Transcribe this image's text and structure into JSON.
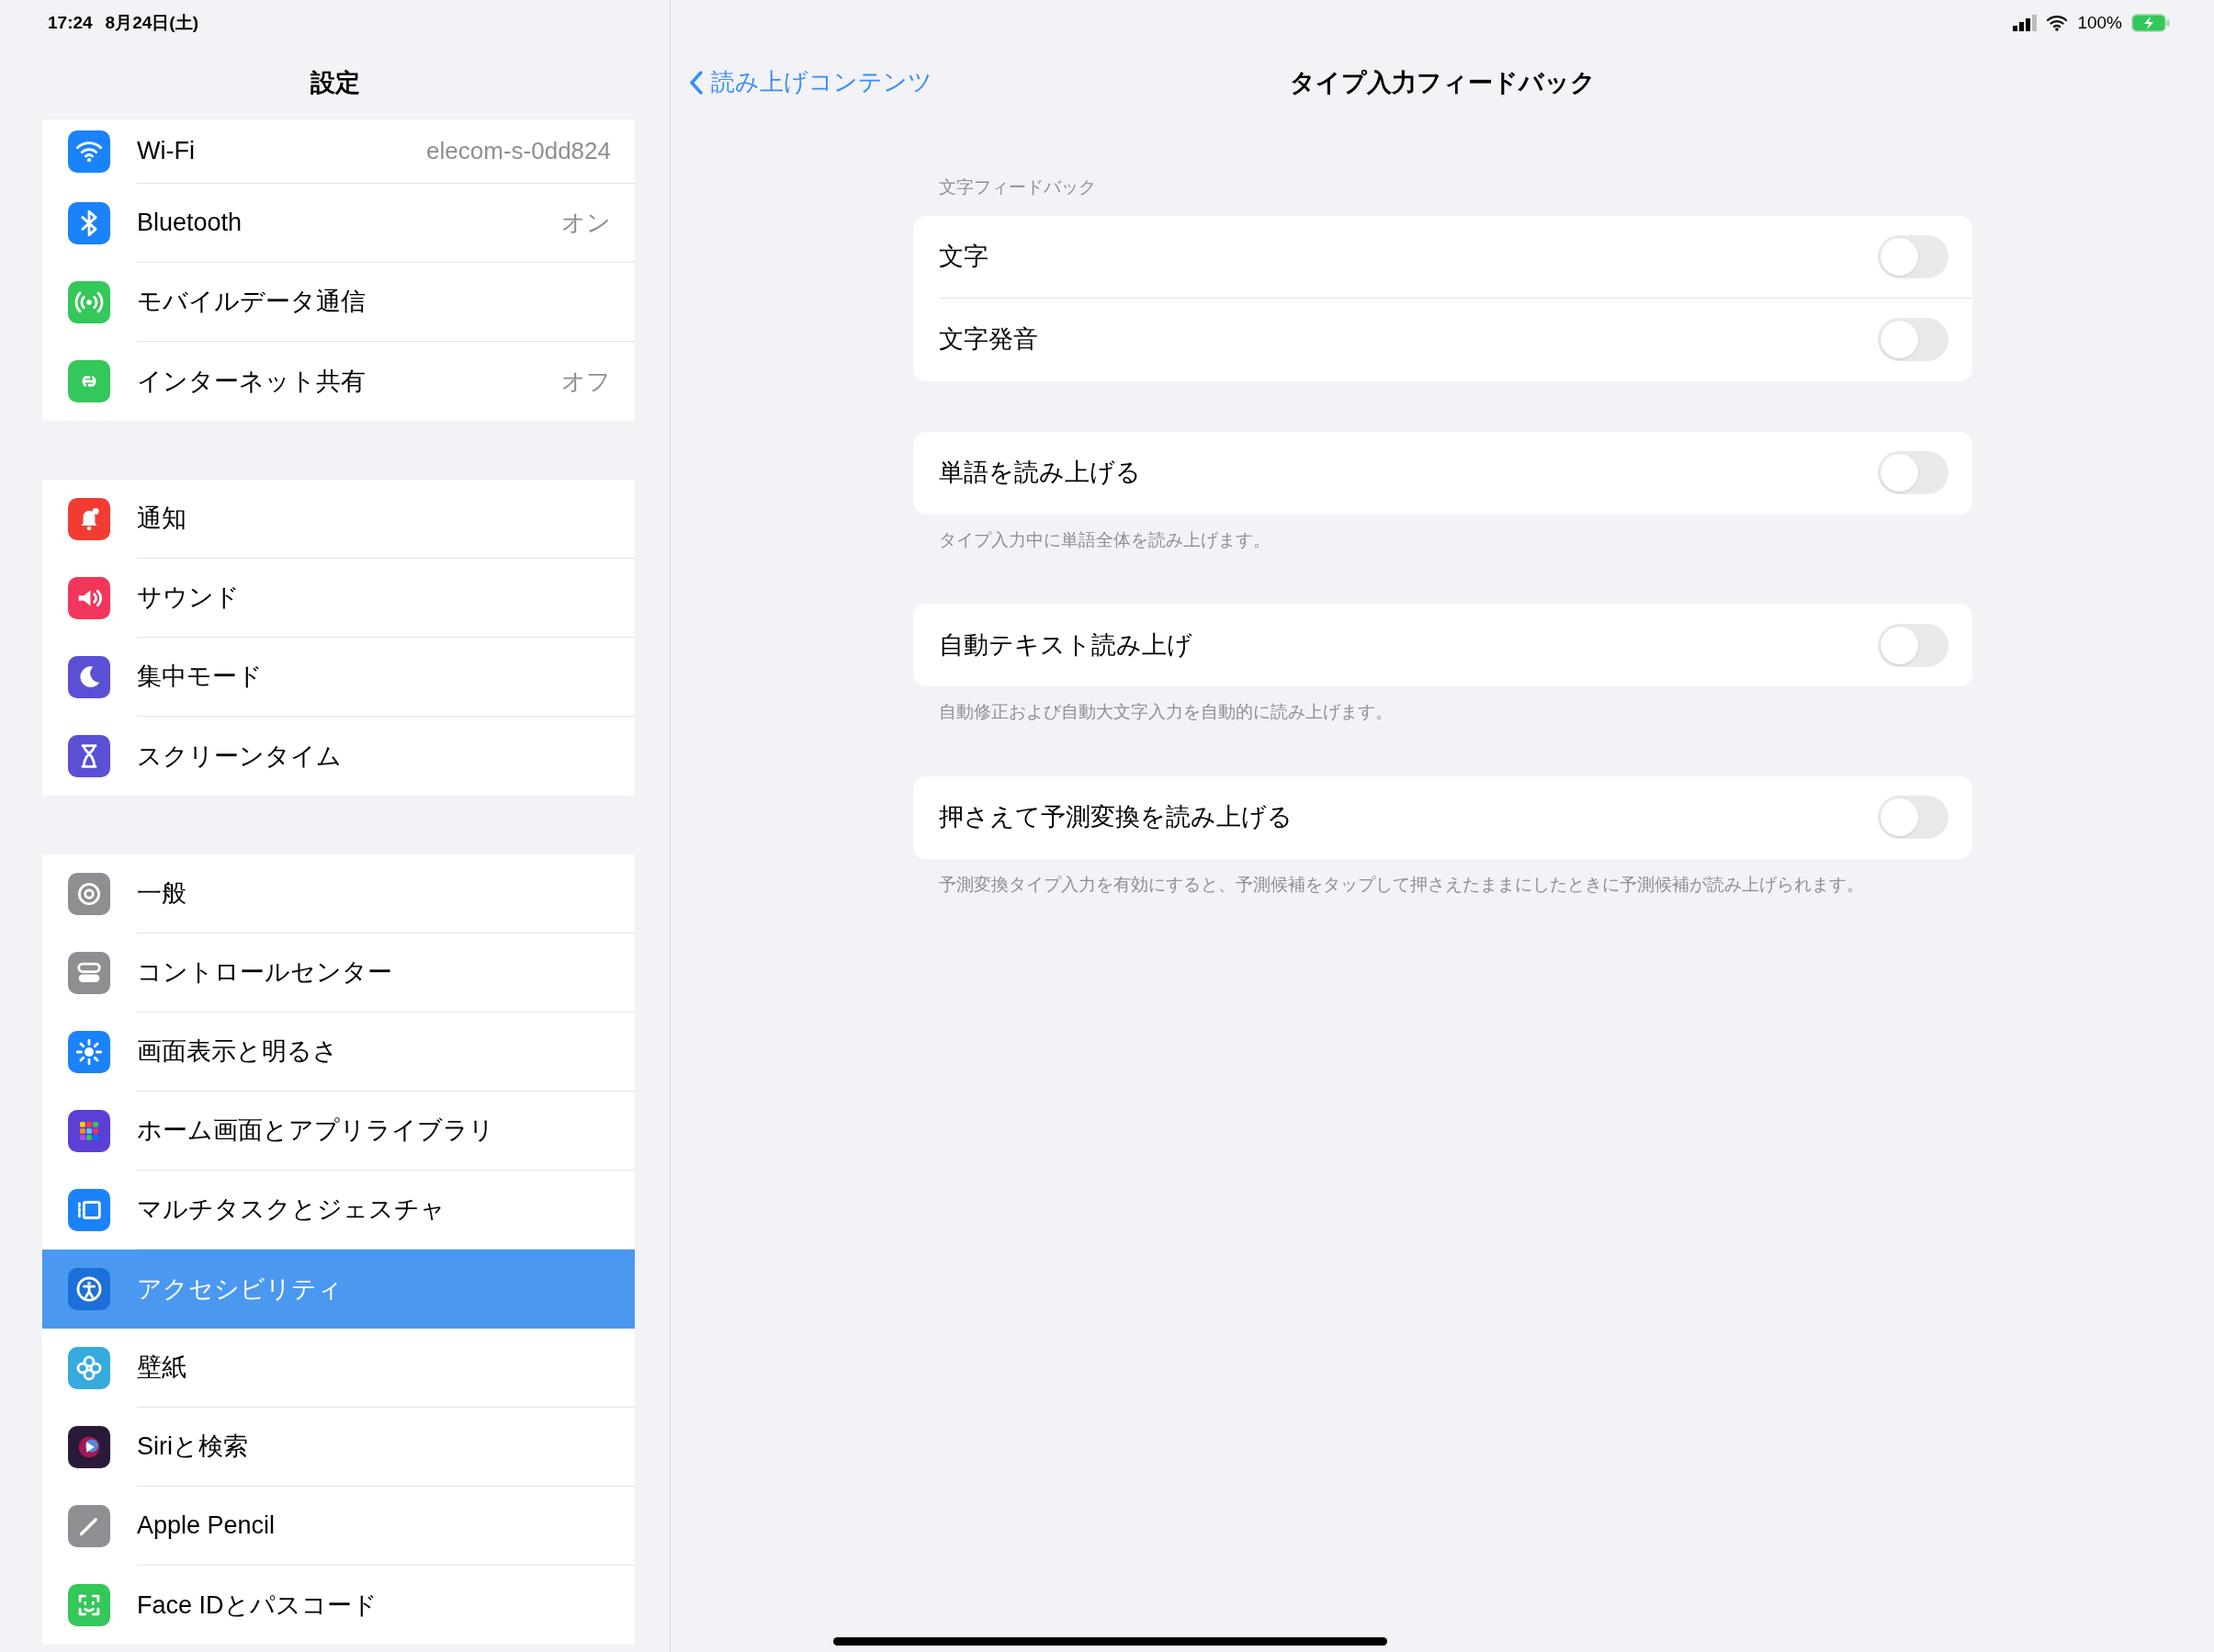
{
  "status_bar": {
    "time": "17:24",
    "date": "8月24日(土)",
    "battery": "100%"
  },
  "sidebar": {
    "title": "設定",
    "groups": [
      {
        "items": [
          {
            "label": "Wi-Fi",
            "value": "elecom-s-0dd824",
            "color": "#1a82fb",
            "selected": false
          },
          {
            "label": "Bluetooth",
            "value": "オン",
            "color": "#1a82fb",
            "selected": false
          },
          {
            "label": "モバイルデータ通信",
            "color": "#34c759",
            "selected": false
          },
          {
            "label": "インターネット共有",
            "value": "オフ",
            "color": "#34c759",
            "selected": false
          }
        ]
      },
      {
        "items": [
          {
            "label": "通知",
            "color": "#f23c32",
            "selected": false
          },
          {
            "label": "サウンド",
            "color": "#f2365b",
            "selected": false
          },
          {
            "label": "集中モード",
            "color": "#5b4fd6",
            "selected": false
          },
          {
            "label": "スクリーンタイム",
            "color": "#5b4fd6",
            "selected": false
          }
        ]
      },
      {
        "items": [
          {
            "label": "一般",
            "color": "#8e8e93",
            "selected": false
          },
          {
            "label": "コントロールセンター",
            "color": "#8e8e93",
            "selected": false
          },
          {
            "label": "画面表示と明るさ",
            "color": "#1a82fb",
            "selected": false
          },
          {
            "label": "ホーム画面とアプリライブラリ",
            "color": "#5b3fd6",
            "selected": false
          },
          {
            "label": "マルチタスクとジェスチャ",
            "color": "#1a82fb",
            "selected": false
          },
          {
            "label": "アクセシビリティ",
            "color": "#1c6fd8",
            "selected": true
          },
          {
            "label": "壁紙",
            "color": "#35aadc",
            "selected": false
          },
          {
            "label": "Siriと検索",
            "color": "#2a1a3a",
            "selected": false
          },
          {
            "label": "Apple Pencil",
            "color": "#8e8e93",
            "selected": false
          },
          {
            "label": "Face IDとパスコード",
            "color": "#34c759",
            "selected": false
          }
        ]
      }
    ]
  },
  "detail": {
    "back": "読み上げコンテンツ",
    "title": "タイプ入力フィードバック",
    "sections": [
      {
        "header": "文字フィードバック",
        "rows": [
          {
            "label": "文字",
            "on": false
          },
          {
            "label": "文字発音",
            "on": false
          }
        ]
      },
      {
        "rows": [
          {
            "label": "単語を読み上げる",
            "on": false
          }
        ],
        "footer": "タイプ入力中に単語全体を読み上げます。"
      },
      {
        "rows": [
          {
            "label": "自動テキスト読み上げ",
            "on": false
          }
        ],
        "footer": "自動修正および自動大文字入力を自動的に読み上げます。"
      },
      {
        "rows": [
          {
            "label": "押さえて予測変換を読み上げる",
            "on": false
          }
        ],
        "footer": "予測変換タイプ入力を有効にすると、予測候補をタップして押さえたままにしたときに予測候補が読み上げられます。"
      }
    ]
  }
}
